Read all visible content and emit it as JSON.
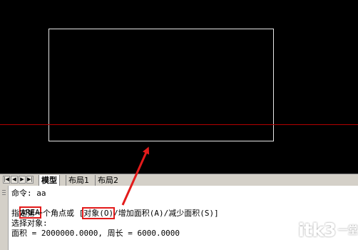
{
  "tabs": {
    "nav_first": "|◀",
    "nav_prev": "◀",
    "nav_next": "▶",
    "nav_last": "▶|",
    "model": "模型",
    "layout1": "布局1",
    "layout2": "布局2"
  },
  "command": {
    "line1": "命令: aa",
    "line2": "AREA",
    "line3_pre": "指定第一个角点或 [",
    "line3_obj": "对象(O)",
    "line3_post": "/增加面积(A)/减少面积(S)]",
    "line4": "选择对象:",
    "line5": "面积 = 2000000.0000, 周长 = 6000.0000"
  },
  "watermark": {
    "main": "itk3",
    "side": "一堂课"
  },
  "colors": {
    "highlight": "#e31b1b",
    "drawing_line": "#b30000",
    "canvas": "#000000"
  }
}
